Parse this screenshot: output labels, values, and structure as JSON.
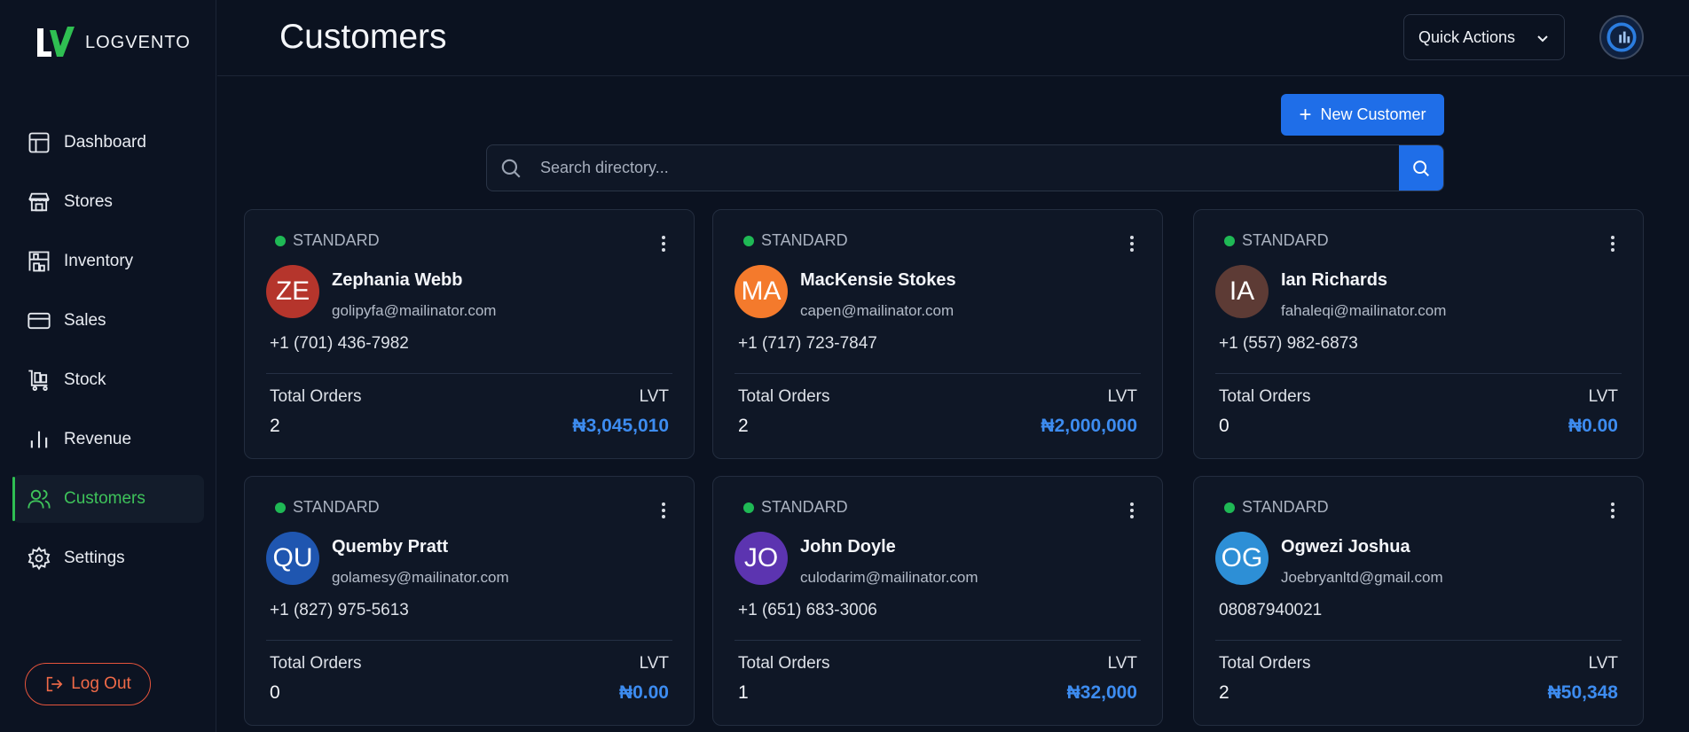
{
  "app": {
    "name": "LOGVENTO"
  },
  "sidebar": {
    "items": [
      {
        "label": "Dashboard",
        "icon": "dashboard-icon"
      },
      {
        "label": "Stores",
        "icon": "store-icon"
      },
      {
        "label": "Inventory",
        "icon": "inventory-icon"
      },
      {
        "label": "Sales",
        "icon": "credit-card-icon"
      },
      {
        "label": "Stock",
        "icon": "cart-icon"
      },
      {
        "label": "Revenue",
        "icon": "bar-chart-icon"
      },
      {
        "label": "Customers",
        "icon": "users-icon",
        "active": true
      },
      {
        "label": "Settings",
        "icon": "gear-icon"
      }
    ],
    "logout_label": "Log Out"
  },
  "header": {
    "title": "Customers",
    "quick_actions_label": "Quick Actions"
  },
  "toolbar": {
    "new_customer_label": "New Customer",
    "search_placeholder": "Search directory..."
  },
  "colors": {
    "accent_blue": "#1f6ee8",
    "active_green": "#3ec25a",
    "logout_orange": "#f06a48",
    "amount_blue": "#3d8cf0"
  },
  "customers": [
    {
      "status": "STANDARD",
      "initials": "ZE",
      "avatar_color": "#b5352c",
      "name": "Zephania Webb",
      "email": "golipyfa@mailinator.com",
      "phone": "+1 (701) 436-7982",
      "orders_label": "Total Orders",
      "orders": "2",
      "lvt_label": "LVT",
      "lvt": "₦3,045,010"
    },
    {
      "status": "STANDARD",
      "initials": "MA",
      "avatar_color": "#f47a2c",
      "name": "MacKensie Stokes",
      "email": "capen@mailinator.com",
      "phone": "+1 (717) 723-7847",
      "orders_label": "Total Orders",
      "orders": "2",
      "lvt_label": "LVT",
      "lvt": "₦2,000,000"
    },
    {
      "status": "STANDARD",
      "initials": "IA",
      "avatar_color": "#5d3b35",
      "name": "Ian Richards",
      "email": "fahaleqi@mailinator.com",
      "phone": "+1 (557) 982-6873",
      "orders_label": "Total Orders",
      "orders": "0",
      "lvt_label": "LVT",
      "lvt": "₦0.00"
    },
    {
      "status": "STANDARD",
      "initials": "QU",
      "avatar_color": "#1f56b0",
      "name": "Quemby Pratt",
      "email": "golamesy@mailinator.com",
      "phone": "+1 (827) 975-5613",
      "orders_label": "Total Orders",
      "orders": "0",
      "lvt_label": "LVT",
      "lvt": "₦0.00"
    },
    {
      "status": "STANDARD",
      "initials": "JO",
      "avatar_color": "#5c34b0",
      "name": "John Doyle",
      "email": "culodarim@mailinator.com",
      "phone": "+1 (651) 683-3006",
      "orders_label": "Total Orders",
      "orders": "1",
      "lvt_label": "LVT",
      "lvt": "₦32,000"
    },
    {
      "status": "STANDARD",
      "initials": "OG",
      "avatar_color": "#2d8fd6",
      "name": "Ogwezi Joshua",
      "email": "Joebryanltd@gmail.com",
      "phone": "08087940021",
      "orders_label": "Total Orders",
      "orders": "2",
      "lvt_label": "LVT",
      "lvt": "₦50,348"
    }
  ]
}
